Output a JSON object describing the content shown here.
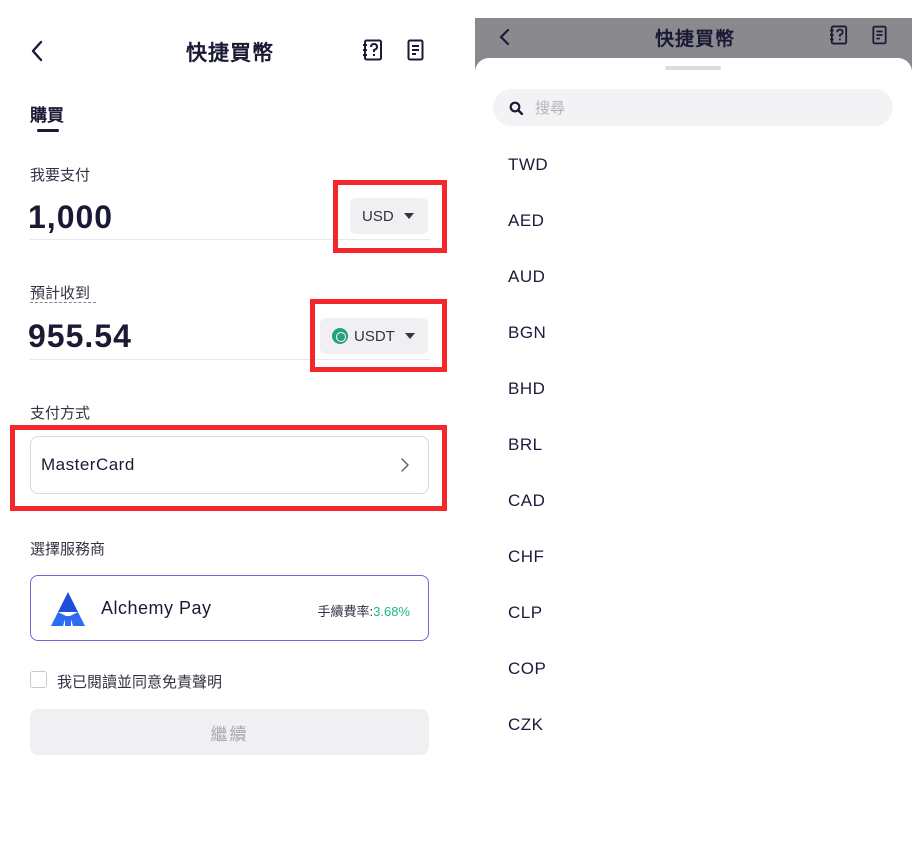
{
  "left": {
    "header": {
      "title": "快捷買幣",
      "back_icon": "chevron-left-icon",
      "help_icon": "help-doc-icon",
      "orders_icon": "orders-list-icon"
    },
    "tab": {
      "label": "購買"
    },
    "pay": {
      "label": "我要支付",
      "amount": "1,000",
      "currency": "USD"
    },
    "receive": {
      "label": "預計收到",
      "amount": "955.54",
      "currency": "USDT",
      "currency_icon": "tether-icon"
    },
    "payment_method": {
      "label": "支付方式",
      "value": "MasterCard"
    },
    "provider": {
      "label": "選擇服務商",
      "name": "Alchemy Pay",
      "fee_label": "手續費率:",
      "fee_value": "3.68%"
    },
    "agree": {
      "text": "我已閱讀並同意免責聲明"
    },
    "continue_label": "繼續"
  },
  "right": {
    "header": {
      "title": "快捷買幣"
    },
    "search": {
      "placeholder": "搜尋"
    },
    "currencies": [
      "TWD",
      "AED",
      "AUD",
      "BGN",
      "BHD",
      "BRL",
      "CAD",
      "CHF",
      "CLP",
      "COP",
      "CZK"
    ]
  },
  "colors": {
    "highlight": "#f2282d",
    "brand": "#1b1a35",
    "accent_fee": "#1fb58a",
    "provider_border": "#7b61d8"
  }
}
